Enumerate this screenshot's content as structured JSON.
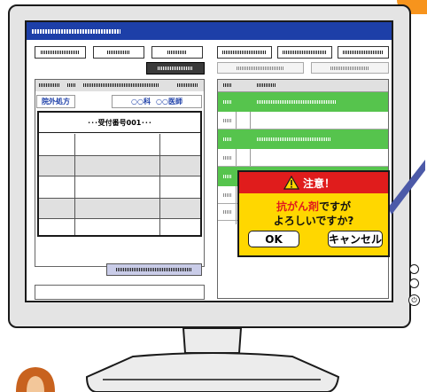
{
  "prescription": {
    "tab_label": "院外処方",
    "department_label": "○○科",
    "doctor_label": "○○医師",
    "receipt_label": "･･･受付番号001･･･"
  },
  "dialog": {
    "title": "注意！",
    "drug_word": "抗がん剤",
    "line1_rest": "ですが",
    "line2": "よろしいですか?",
    "ok_label": "OK",
    "cancel_label": "キャンセル"
  },
  "colors": {
    "titlebar": "#1d3fa8",
    "green_row": "#56c44d",
    "dialog_bg": "#ffd700",
    "dialog_head": "#e01c1c",
    "accent_orange": "#f7941d"
  }
}
